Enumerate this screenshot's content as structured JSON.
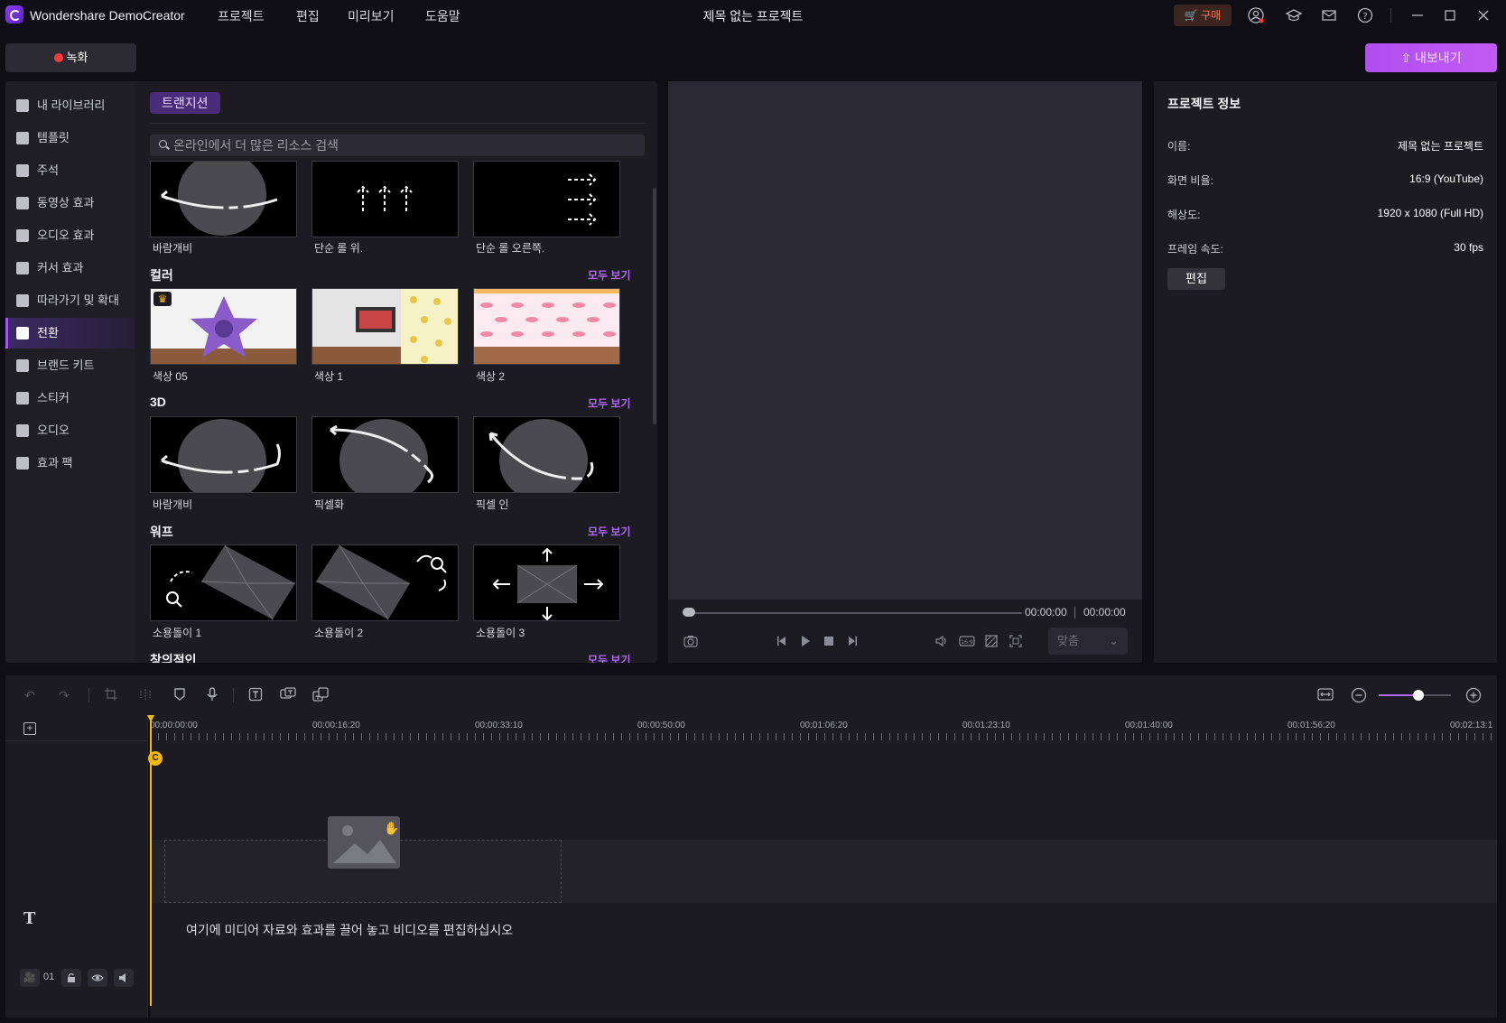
{
  "app": {
    "name": "Wondershare DemoCreator",
    "title": "제목 없는 프로젝트"
  },
  "menu": [
    "프로젝트",
    "편집",
    "미리보기",
    "도움말"
  ],
  "titlebar": {
    "buy_label": "구매",
    "icons": [
      "cart-icon",
      "user-icon",
      "academy-icon",
      "mail-icon",
      "help-icon",
      "minimize-icon",
      "maximize-icon",
      "close-icon"
    ]
  },
  "toolbar": {
    "record_label": "녹화",
    "export_label": "내보내기"
  },
  "sidebar": {
    "items": [
      {
        "label": "내 라이브러리",
        "icon": "layers-icon"
      },
      {
        "label": "템플릿",
        "icon": "template-icon"
      },
      {
        "label": "주석",
        "icon": "annotation-icon"
      },
      {
        "label": "동영상 효과",
        "icon": "video-effect-icon"
      },
      {
        "label": "오디오 효과",
        "icon": "audio-effect-icon"
      },
      {
        "label": "커서 효과",
        "icon": "cursor-effect-icon"
      },
      {
        "label": "따라가기 및 확대",
        "icon": "zoom-follow-icon"
      },
      {
        "label": "전환",
        "icon": "transition-icon",
        "active": true
      },
      {
        "label": "브랜드 키트",
        "icon": "brand-kit-icon"
      },
      {
        "label": "스티커",
        "icon": "sticker-icon"
      },
      {
        "label": "오디오",
        "icon": "music-icon"
      },
      {
        "label": "효과 팩",
        "icon": "effect-pack-icon"
      }
    ]
  },
  "resources": {
    "tab_label": "트랜지션",
    "search_placeholder": "온라인에서 더 많은 리소스 검색",
    "see_all": "모두 보기",
    "top_row": [
      "바람개비",
      "단순 롤 위.",
      "단순 롤 오른쪽."
    ],
    "sections": [
      {
        "title": "컬러",
        "items": [
          "색상 05",
          "색상 1",
          "색상 2"
        ]
      },
      {
        "title": "3D",
        "items": [
          "바람개비",
          "픽셀화",
          "픽셀 인"
        ]
      },
      {
        "title": "워프",
        "items": [
          "소용돌이 1",
          "소용돌이 2",
          "소용돌이 3"
        ]
      },
      {
        "title": "창의적인",
        "items": []
      }
    ]
  },
  "preview": {
    "current_time": "00:00:00",
    "total_time": "00:00:00",
    "fit_label": "맞춤"
  },
  "project_info": {
    "title": "프로젝트 정보",
    "rows": [
      {
        "label": "이름:",
        "value": "제목 없는 프로젝트"
      },
      {
        "label": "화면 비율:",
        "value": "16:9 (YouTube)"
      },
      {
        "label": "해상도:",
        "value": "1920 x 1080 (Full HD)"
      },
      {
        "label": "프레임 속도:",
        "value": "30 fps"
      }
    ],
    "edit_label": "편집"
  },
  "timeline": {
    "ruler_labels": [
      "00:00:00:00",
      "00:00:16:20",
      "00:00:33:10",
      "00:00:50:00",
      "00:01:06:20",
      "00:01:23:10",
      "00:01:40:00",
      "00:01:56:20",
      "00:02:13:1"
    ],
    "drop_hint": "여기에 미디어 자료와 효과를 끌어 놓고 비디오를 편집하십시오",
    "track_number": "01",
    "zoom_level": 0.55
  }
}
